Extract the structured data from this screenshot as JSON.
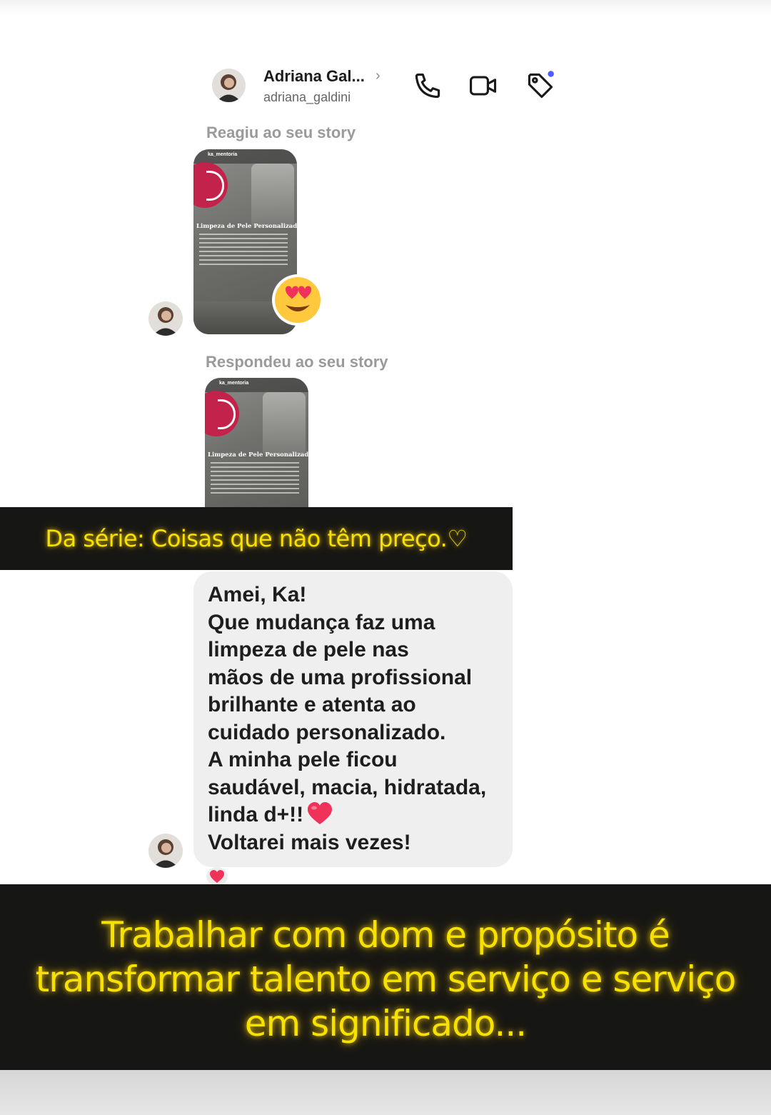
{
  "header": {
    "name": "Adriana Gal...",
    "username": "adriana_galdini",
    "chevron": "›",
    "icons": [
      "phone-icon",
      "video-call-icon",
      "tag-icon"
    ]
  },
  "conversation": {
    "reacted_label": "Reagiu ao seu story",
    "replied_label": "Respondeu ao seu story",
    "reaction_emoji": "heart-eyes-emoji",
    "story": {
      "handle": "ka_mentoria",
      "title": "Limpeza de Pele Personalizada"
    },
    "message": {
      "lines": [
        "Amei, Ka!",
        "Que mudança faz uma",
        "limpeza de pele nas",
        "mãos de uma profissional",
        "brilhante e atenta ao",
        "cuidado personalizado.",
        "A minha pele ficou",
        "saudável, macia, hidratada,",
        "linda d+!!",
        "Voltarei mais vezes!"
      ],
      "reaction": "heart-icon"
    }
  },
  "captions": {
    "series": "Da série: Coisas que não têm preço.♡",
    "closing_lines": [
      "Trabalhar com dom e propósito é",
      "transformar talento em serviço e serviço",
      "em significado..."
    ]
  },
  "colors": {
    "caption_text": "#f7e100",
    "caption_bg": "#161614",
    "bubble_bg": "#efefef",
    "heart": "#f0315a",
    "tag_dot": "#4f5bff"
  }
}
